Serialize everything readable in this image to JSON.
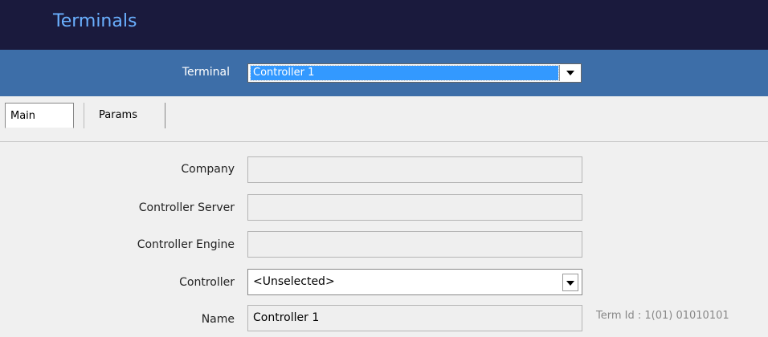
{
  "window": {
    "title": "Terminals"
  },
  "terminal_selector": {
    "label": "Terminal",
    "value": "Controller 1"
  },
  "tabs": [
    {
      "label": "Main"
    },
    {
      "label": "Params"
    }
  ],
  "form": {
    "company": {
      "label": "Company",
      "value": ""
    },
    "controller_server": {
      "label": "Controller Server",
      "value": ""
    },
    "controller_engine": {
      "label": "Controller Engine",
      "value": ""
    },
    "controller": {
      "label": "Controller",
      "value": "<Unselected>"
    },
    "name": {
      "label": "Name",
      "value": "Controller 1"
    }
  },
  "term_id": "Term Id : 1(01) 01010101",
  "colors": {
    "title_bar": "#1a1a3d",
    "selector_bar": "#3d6ea8",
    "title_text": "#6ab0ff",
    "selection": "#3399ff"
  }
}
